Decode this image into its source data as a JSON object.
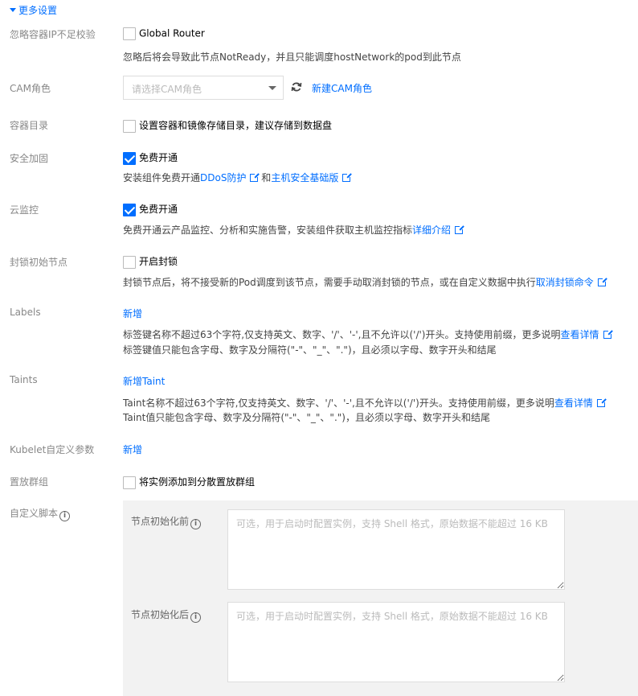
{
  "section": {
    "title": "更多设置"
  },
  "ip_check": {
    "label": "忽略容器IP不足校验",
    "checkbox_label": "Global Router",
    "checked": false,
    "help": "忽略后将会导致此节点NotReady，并且只能调度hostNetwork的pod到此节点"
  },
  "cam": {
    "label": "CAM角色",
    "placeholder": "请选择CAM角色",
    "create_link": "新建CAM角色"
  },
  "container_dir": {
    "label": "容器目录",
    "checkbox_label": "设置容器和镜像存储目录，建议存储到数据盘",
    "checked": false
  },
  "security": {
    "label": "安全加固",
    "checkbox_label": "免费开通",
    "checked": true,
    "help_prefix": "安装组件免费开通",
    "link1": "DDoS防护",
    "help_mid": "和",
    "link2": "主机安全基础版"
  },
  "monitor": {
    "label": "云监控",
    "checkbox_label": "免费开通",
    "checked": true,
    "help_prefix": "免费开通云产品监控、分析和实施告警，安装组件获取主机监控指标",
    "link": "详细介绍"
  },
  "cordon": {
    "label": "封锁初始节点",
    "checkbox_label": "开启封锁",
    "checked": false,
    "help_prefix": "封锁节点后，将不接受新的Pod调度到该节点，需要手动取消封锁的节点，或在自定义数据中执行",
    "link": "取消封锁命令"
  },
  "labels": {
    "label": "Labels",
    "add_link": "新增",
    "help1_prefix": "标签键名称不超过63个字符,仅支持英文、数字、'/'、'-',且不允许以('/')开头。支持使用前缀，更多说明",
    "help1_link": "查看详情",
    "help2": "标签键值只能包含字母、数字及分隔符(\"-\"、\"_\"、\".\")，且必须以字母、数字开头和结尾"
  },
  "taints": {
    "label": "Taints",
    "add_link": "新增Taint",
    "help1_prefix": "Taint名称不超过63个字符,仅支持英文、数字、'/'、'-',且不允许以('/')开头。支持使用前缀，更多说明",
    "help1_link": "查看详情",
    "help2": "Taint值只能包含字母、数字及分隔符(\"-\"、\"_\"、\".\")，且必须以字母、数字开头和结尾"
  },
  "kubelet": {
    "label": "Kubelet自定义参数",
    "add_link": "新增"
  },
  "placement": {
    "label": "置放群组",
    "checkbox_label": "将实例添加到分散置放群组",
    "checked": false
  },
  "script": {
    "label": "自定义脚本",
    "before_label": "节点初始化前",
    "before_placeholder": "可选，用于启动时配置实例，支持 Shell 格式，原始数据不能超过 16 KB",
    "after_label": "节点初始化后",
    "after_placeholder": "可选，用于启动时配置实例，支持 Shell 格式，原始数据不能超过 16 KB"
  },
  "colors": {
    "accent": "#006eff",
    "label": "#888888",
    "panel": "#f2f2f2"
  }
}
